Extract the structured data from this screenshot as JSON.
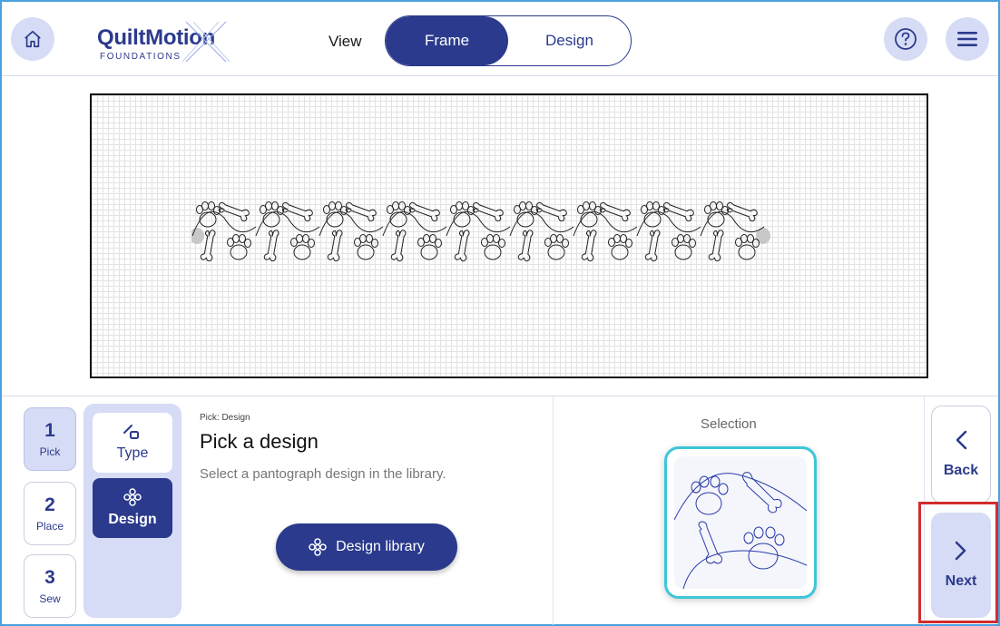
{
  "header": {
    "logo_main": "QuiltMotion",
    "logo_sub": "FOUNDATIONS",
    "view_label": "View",
    "tabs": [
      {
        "label": "Frame",
        "active": true
      },
      {
        "label": "Design",
        "active": false
      }
    ],
    "icons": {
      "home": "home-icon",
      "help": "help-icon",
      "menu": "menu-icon"
    }
  },
  "steps": [
    {
      "num": "1",
      "label": "Pick",
      "active": true
    },
    {
      "num": "2",
      "label": "Place",
      "active": false
    },
    {
      "num": "3",
      "label": "Sew",
      "active": false
    }
  ],
  "substeps": {
    "type_label": "Type",
    "design_label": "Design"
  },
  "info": {
    "eyebrow": "Pick: Design",
    "title": "Pick a design",
    "description": "Select a pantograph design in the library.",
    "library_button": "Design library"
  },
  "selection": {
    "label": "Selection"
  },
  "nav": {
    "back_label": "Back",
    "next_label": "Next"
  },
  "colors": {
    "primary": "#2b3a8c",
    "light": "#d6dcf5",
    "accent": "#3ec6d8",
    "highlight": "#d12c2c"
  }
}
